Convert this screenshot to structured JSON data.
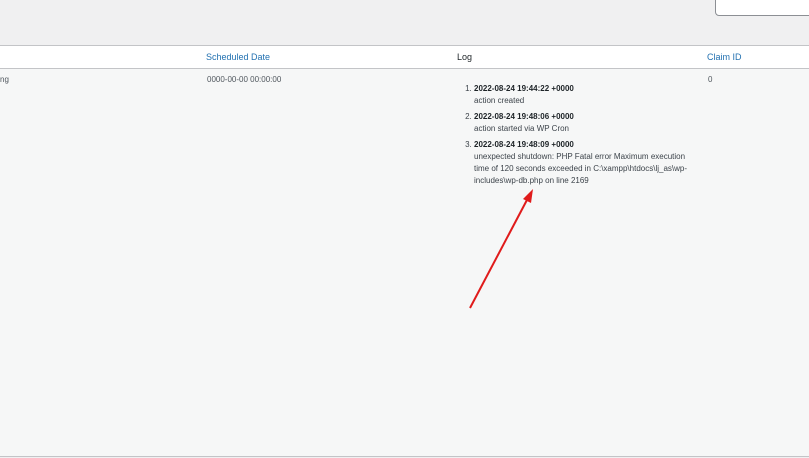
{
  "table": {
    "columns": {
      "scheduled_date": "Scheduled Date",
      "log": "Log",
      "claim_id": "Claim ID"
    },
    "row": {
      "status_fragment": "ng",
      "scheduled_date": "0000-00-00 00:00:00",
      "claim_id": "0",
      "log_entries": [
        {
          "timestamp": "2022-08-24 19:44:22 +0000",
          "message": "action created"
        },
        {
          "timestamp": "2022-08-24 19:48:06 +0000",
          "message": "action started via WP Cron"
        },
        {
          "timestamp": "2022-08-24 19:48:09 +0000",
          "message_lines": [
            "unexpected shutdown: PHP Fatal error Maximum execution",
            "time of 120 seconds exceeded in C:\\xampp\\htdocs\\lj_as\\wp-",
            "includes\\wp-db.php on line 2169"
          ]
        }
      ]
    }
  },
  "colors": {
    "link": "#2271b1",
    "annotation_arrow": "#e01b1b"
  }
}
